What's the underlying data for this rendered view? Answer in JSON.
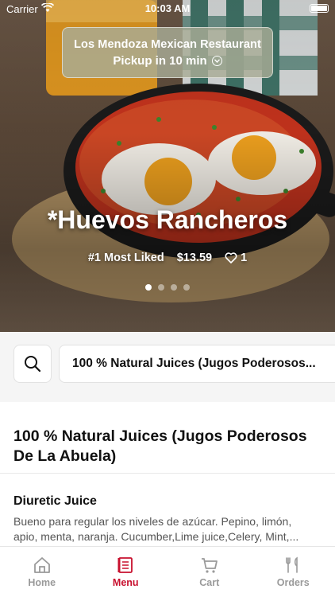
{
  "status_bar": {
    "carrier": "Carrier",
    "time": "10:03 AM"
  },
  "restaurant": {
    "name": "Los Mendoza Mexican Restaurant",
    "pickup": "Pickup in 10 min"
  },
  "featured": {
    "title": "*Huevos Rancheros",
    "rank": "#1 Most Liked",
    "price": "$13.59",
    "likes": "1",
    "slide_count": 4,
    "active_slide": 1
  },
  "search": {
    "icon": "search-icon",
    "category": "100 % Natural Juices (Jugos Poderosos..."
  },
  "section": {
    "title": "100 % Natural Juices (Jugos Poderosos De La Abuela)",
    "items": [
      {
        "name": "Diuretic Juice",
        "desc_line1": "Bueno para regular los niveles de azúcar.  Pepino, limón,",
        "desc_line2": "apio, menta, naranja. Cucumber,Lime juice,Celery, Mint,..."
      }
    ]
  },
  "tabs": [
    {
      "label": "Home",
      "icon": "home-icon"
    },
    {
      "label": "Menu",
      "icon": "menu-icon",
      "active": true
    },
    {
      "label": "Cart",
      "icon": "cart-icon"
    },
    {
      "label": "Orders",
      "icon": "orders-icon"
    }
  ],
  "colors": {
    "accent": "#c8102e",
    "inactive_tab": "#9a9a9a"
  }
}
